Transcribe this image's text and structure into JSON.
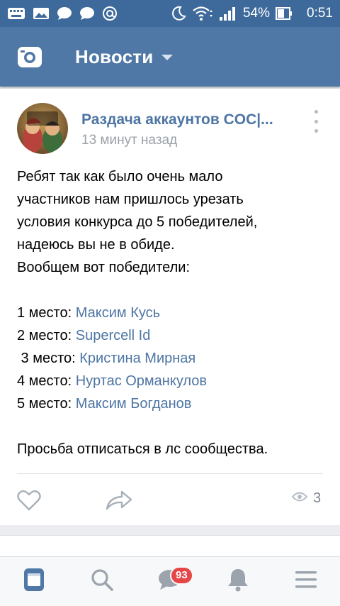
{
  "status_bar": {
    "battery": "54%",
    "time": "0:51"
  },
  "header": {
    "title": "Новости"
  },
  "post": {
    "author": "Раздача аккаунтов COC|...",
    "time": "13 минут назад",
    "avatar_text": "Clash FREE халява",
    "text_lines": [
      "Ребят так как было очень мало",
      "участников нам пришлось урезать",
      "условия конкурса до 5 победителей,",
      "надеюсь вы не в обиде.",
      "Вообщем вот победители:"
    ],
    "winners": [
      {
        "place": "1 место: ",
        "name": "Максим Кусь"
      },
      {
        "place": "2 место: ",
        "name": "Supercell Id"
      },
      {
        "place": " 3 место: ",
        "name": "Кристина Мирная"
      },
      {
        "place": "4 место: ",
        "name": "Нуртас Орманкулов"
      },
      {
        "place": "5 место: ",
        "name": "Максим Богданов"
      }
    ],
    "footer_text": "Просьба отписаться в лс сообщества.",
    "views": "3"
  },
  "tabbar": {
    "messages_badge": "93"
  },
  "colors": {
    "status_bar": "#3e6a9b",
    "header": "#4f78a6",
    "link": "#4d75a3",
    "badge": "#e64646"
  },
  "icons": {
    "status_left": [
      "keyboard-icon",
      "image-icon",
      "chat-bubble-icon",
      "chat-bubble-icon",
      "at-icon"
    ],
    "status_right": [
      "moon-icon",
      "wifi-icon",
      "signal-icon",
      "battery-icon"
    ],
    "header": "camera-icon",
    "actions": [
      "heart-icon",
      "share-icon",
      "eye-icon"
    ],
    "tabs": [
      "news-icon",
      "search-icon",
      "messages-icon",
      "bell-icon",
      "menu-icon"
    ]
  }
}
